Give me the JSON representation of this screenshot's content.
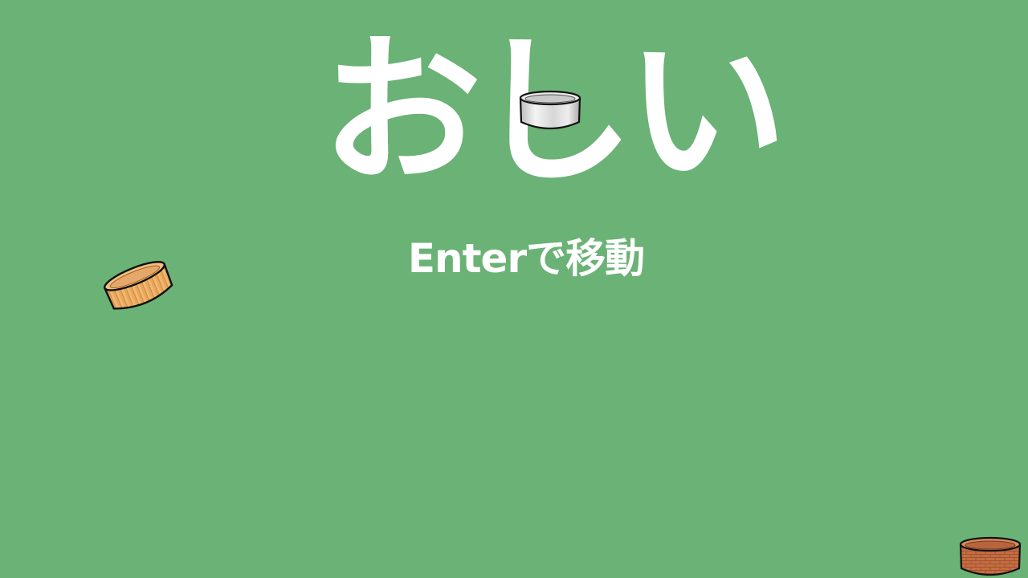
{
  "title": {
    "text": "おしい"
  },
  "prompt": {
    "text": "Enterで移動"
  },
  "tubs": [
    {
      "name": "metal-tub",
      "material": "metal",
      "colors": {
        "light": "#f2f2f2",
        "mid": "#d4d4d4",
        "dark": "#a9a9a9"
      }
    },
    {
      "name": "wooden-tub",
      "material": "wood",
      "colors": {
        "light": "#f3c07c",
        "mid": "#e2a056",
        "dark": "#c98338"
      }
    },
    {
      "name": "brick-tub",
      "material": "brick",
      "colors": {
        "light": "#d98a60",
        "mid": "#c26a40",
        "dark": "#a3532e"
      }
    }
  ],
  "colors": {
    "background": "#6ab275",
    "text": "#ffffff",
    "outline": "#111111"
  }
}
